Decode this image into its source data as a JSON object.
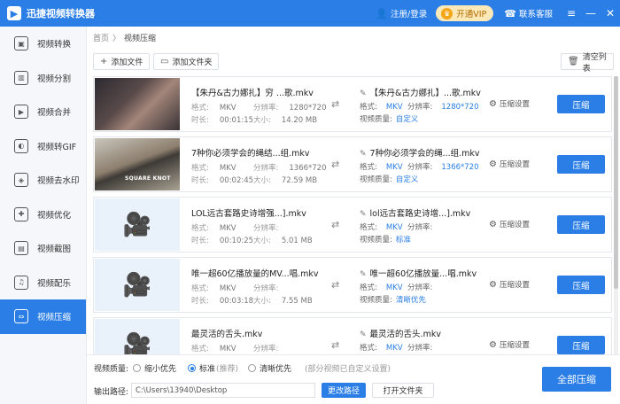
{
  "app": {
    "title": "迅捷视频转换器",
    "login": "注册/登录",
    "vip": "开通VIP",
    "service": "联系客服"
  },
  "sidebar": {
    "items": [
      {
        "label": "视频转换",
        "icon": "video-convert-icon"
      },
      {
        "label": "视频分割",
        "icon": "split-icon"
      },
      {
        "label": "视频合并",
        "icon": "merge-icon"
      },
      {
        "label": "视频转GIF",
        "icon": "gif-icon"
      },
      {
        "label": "视频去水印",
        "icon": "watermark-icon"
      },
      {
        "label": "视频优化",
        "icon": "optimize-icon"
      },
      {
        "label": "视频截图",
        "icon": "screenshot-icon"
      },
      {
        "label": "视频配乐",
        "icon": "music-icon"
      },
      {
        "label": "视频压缩",
        "icon": "compress-icon",
        "active": true
      }
    ]
  },
  "breadcrumb": {
    "home": "首页",
    "sep": "〉",
    "current": "视频压缩"
  },
  "toolbar": {
    "add_file": "添加文件",
    "add_folder": "添加文件夹",
    "clear": "清空列表"
  },
  "labels": {
    "format": "格式:",
    "duration": "时长:",
    "resolution": "分辨率:",
    "size": "大小:",
    "quality": "视频质量:",
    "settings": "压缩设置",
    "compress": "压缩"
  },
  "files": [
    {
      "name": "【朱丹&古力娜扎】穷 ...歌.mkv",
      "format": "MKV",
      "resolution": "1280*720",
      "duration": "00:01:15",
      "size": "14.20 MB",
      "out_name": "【朱丹&古力娜扎】...歌.mkv",
      "out_format": "MKV",
      "out_resolution": "1280*720",
      "quality": "自定义",
      "thumb": "photo1"
    },
    {
      "name": "7种你必须学会的绳结...组.mkv",
      "format": "MKV",
      "resolution": "1366*720",
      "duration": "00:02:45",
      "size": "72.59 MB",
      "out_name": "7种你必须学会的绳...组.mkv",
      "out_format": "MKV",
      "out_resolution": "1366*720",
      "quality": "自定义",
      "thumb": "photo2"
    },
    {
      "name": "LOL远古套路史诗增强...].mkv",
      "format": "MKV",
      "resolution": "",
      "duration": "00:10:25",
      "size": "5.01 MB",
      "out_name": "lol远古套路史诗增...].mkv",
      "out_format": "MKV",
      "out_resolution": "",
      "quality": "标准",
      "thumb": "placeholder"
    },
    {
      "name": "唯一超60亿播放量的MV...唱.mkv",
      "format": "MKV",
      "resolution": "",
      "duration": "00:03:18",
      "size": "7.55 MB",
      "out_name": "唯一超60亿播放量...唱.mkv",
      "out_format": "MKV",
      "out_resolution": "",
      "quality": "清晰优先",
      "thumb": "placeholder"
    },
    {
      "name": "最灵活的舌头.mkv",
      "format": "MKV",
      "resolution": "",
      "duration": "",
      "size": "",
      "out_name": "最灵活的舌头.mkv",
      "out_format": "MKV",
      "out_resolution": "",
      "quality": "",
      "thumb": "placeholder"
    }
  ],
  "thumb_caption": "SQUARE KNOT",
  "bottom": {
    "quality_label": "视频质量:",
    "opt_small": "缩小优先",
    "opt_standard": "标准",
    "recommended": "(推荐)",
    "opt_clear": "清晰优先",
    "note": "(部分视频已自定义设置)",
    "path_label": "输出路径:",
    "path_value": "C:\\Users\\13940\\Desktop",
    "change_path": "更改路径",
    "open_folder": "打开文件夹",
    "compress_all": "全部压缩"
  },
  "colors": {
    "accent": "#2a7ee6",
    "vip_bg": "#fde9b8"
  }
}
